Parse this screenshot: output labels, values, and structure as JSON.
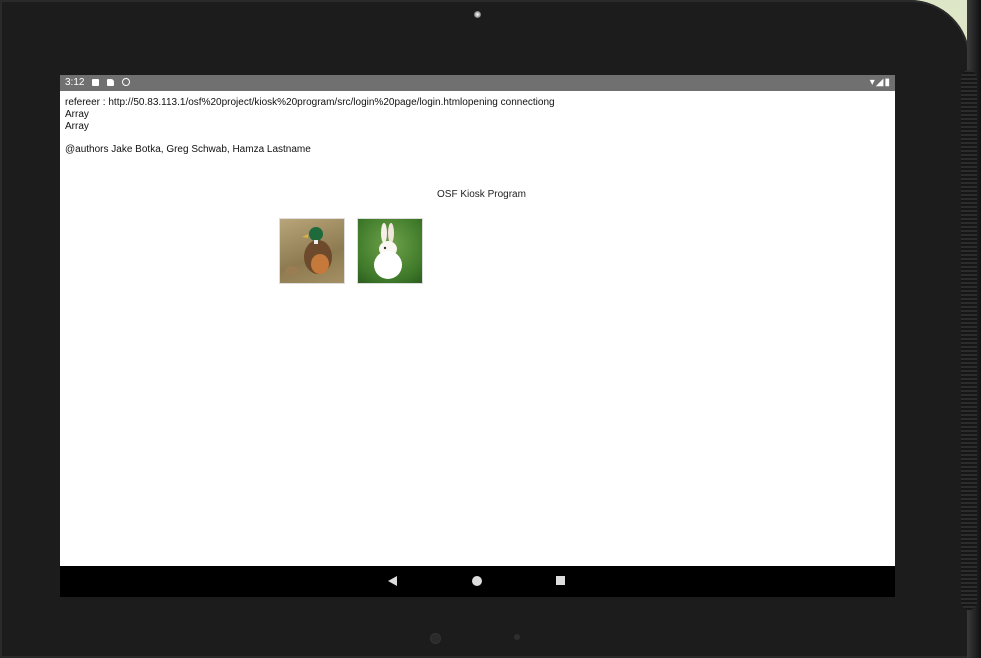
{
  "status_bar": {
    "time": "3:12",
    "left_icons": [
      "image-icon",
      "sd-card-icon",
      "sync-icon"
    ],
    "right_icons": "▾◢▮"
  },
  "page": {
    "referrer_line": "refereer : http://50.83.113.1/osf%20project/kiosk%20program/src/login%20page/login.htmlopening connectiong",
    "array_line_1": "Array",
    "array_line_2": "Array",
    "authors": "@authors Jake Botka, Greg Schwab, Hamza Lastname",
    "title": "OSF Kiosk Program"
  },
  "images": [
    {
      "name": "duck-image",
      "subject": "duck"
    },
    {
      "name": "rabbit-image",
      "subject": "rabbit"
    }
  ],
  "nav_bar": {
    "buttons": [
      "back",
      "home",
      "recents"
    ]
  }
}
